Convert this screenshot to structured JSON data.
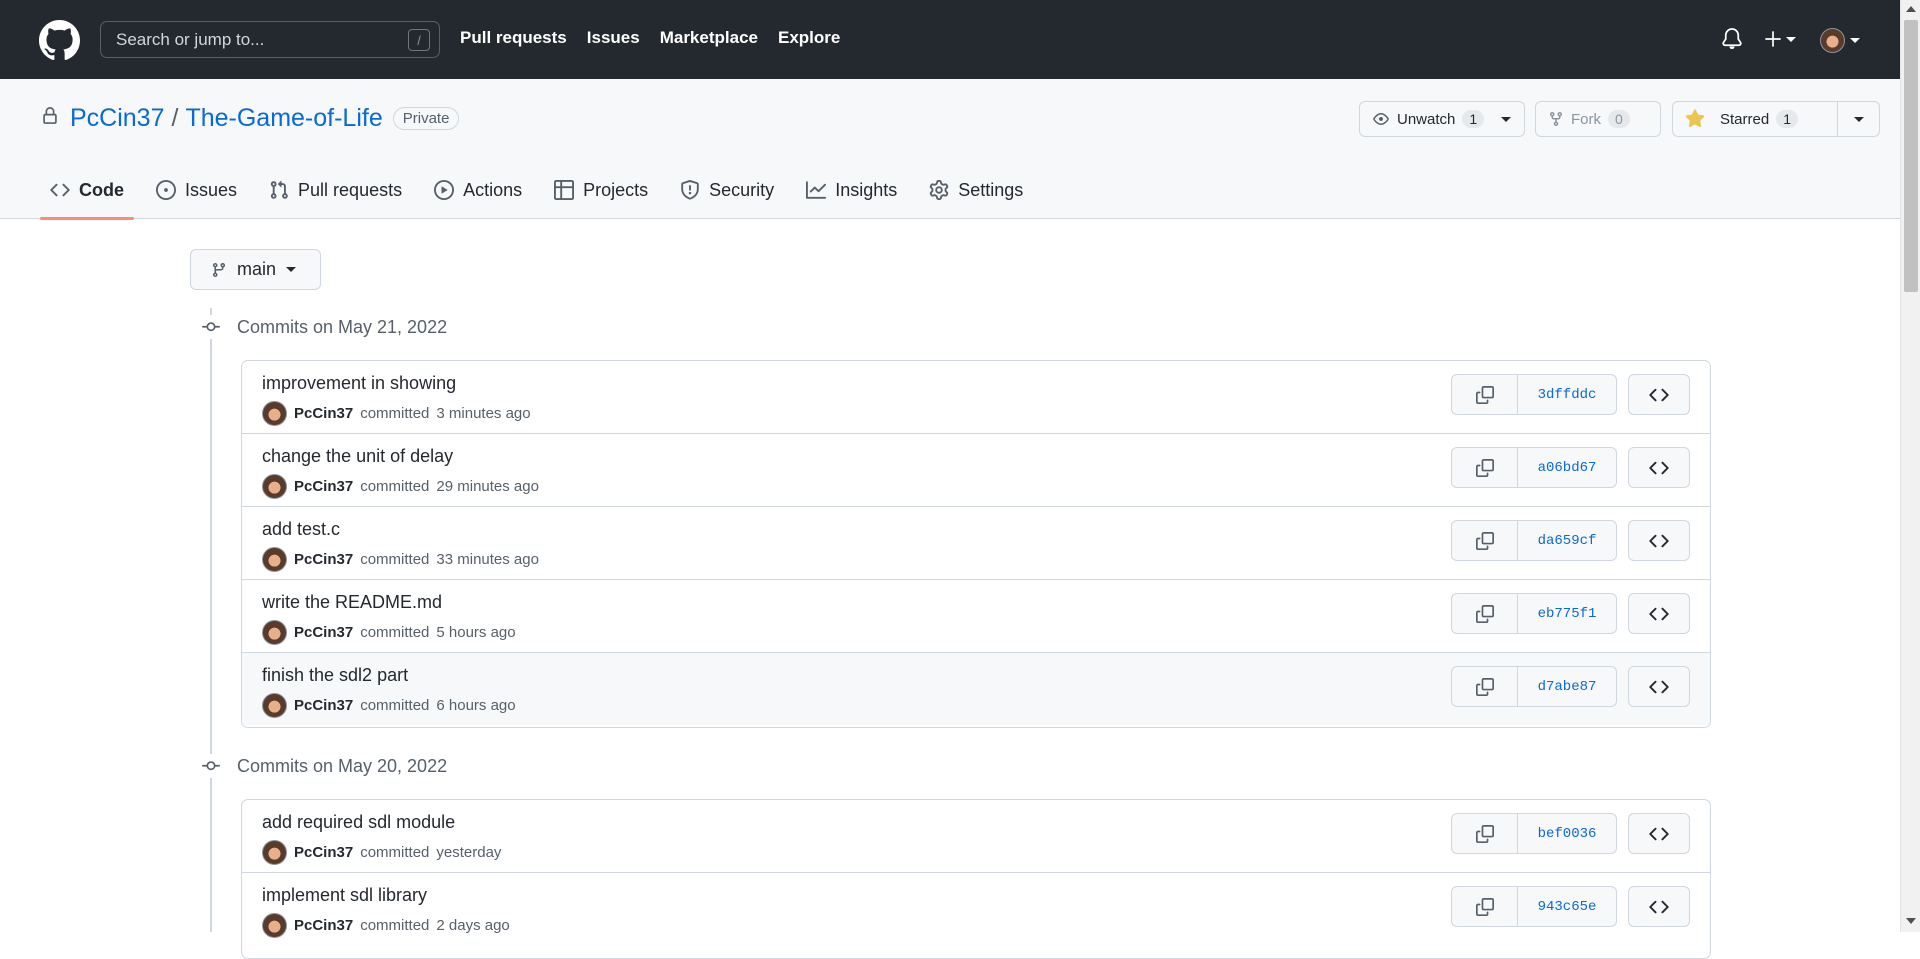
{
  "header": {
    "search_placeholder": "Search or jump to...",
    "search_shortcut": "/",
    "nav": [
      "Pull requests",
      "Issues",
      "Marketplace",
      "Explore"
    ]
  },
  "repo": {
    "owner": "PcCin37",
    "separator": "/",
    "name": "The-Game-of-Life",
    "visibility": "Private",
    "unwatch_label": "Unwatch",
    "watch_count": "1",
    "fork_label": "Fork",
    "fork_count": "0",
    "starred_label": "Starred",
    "star_count": "1",
    "star_color": "#eac54f"
  },
  "tabs": [
    {
      "label": "Code",
      "icon": "code-icon",
      "active": true
    },
    {
      "label": "Issues",
      "icon": "issue-opened-icon"
    },
    {
      "label": "Pull requests",
      "icon": "git-pull-request-icon"
    },
    {
      "label": "Actions",
      "icon": "play-icon"
    },
    {
      "label": "Projects",
      "icon": "table-icon"
    },
    {
      "label": "Security",
      "icon": "shield-icon"
    },
    {
      "label": "Insights",
      "icon": "graph-icon"
    },
    {
      "label": "Settings",
      "icon": "gear-icon"
    }
  ],
  "branch": "main",
  "groups": [
    {
      "heading": "Commits on May 21, 2022",
      "commits": [
        {
          "message": "improvement in showing",
          "author": "PcCin37",
          "verb": "committed",
          "time": "3 minutes ago",
          "sha": "3dffddc"
        },
        {
          "message": "change the unit of delay",
          "author": "PcCin37",
          "verb": "committed",
          "time": "29 minutes ago",
          "sha": "a06bd67"
        },
        {
          "message": "add test.c",
          "author": "PcCin37",
          "verb": "committed",
          "time": "33 minutes ago",
          "sha": "da659cf"
        },
        {
          "message": "write the README.md",
          "author": "PcCin37",
          "verb": "committed",
          "time": "5 hours ago",
          "sha": "eb775f1"
        },
        {
          "message": "finish the sdl2 part",
          "author": "PcCin37",
          "verb": "committed",
          "time": "6 hours ago",
          "sha": "d7abe87"
        }
      ]
    },
    {
      "heading": "Commits on May 20, 2022",
      "commits": [
        {
          "message": "add required sdl module",
          "author": "PcCin37",
          "verb": "committed",
          "time": "yesterday",
          "sha": "bef0036"
        },
        {
          "message": "implement sdl library",
          "author": "PcCin37",
          "verb": "committed",
          "time": "2 days ago",
          "sha": "943c65e"
        }
      ]
    }
  ]
}
